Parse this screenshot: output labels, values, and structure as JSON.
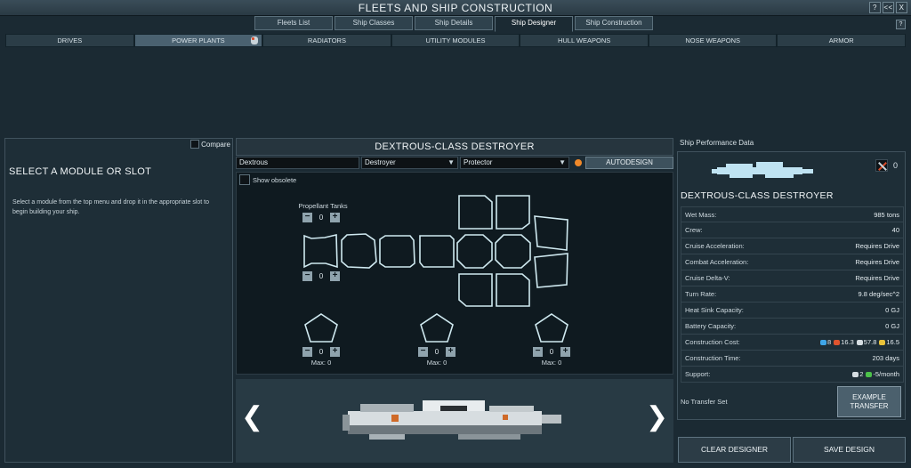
{
  "window": {
    "title": "FLEETS AND SHIP CONSTRUCTION",
    "help": "?",
    "minimize": "<<",
    "close": "X"
  },
  "tabs": [
    {
      "label": "Fleets List"
    },
    {
      "label": "Ship Classes"
    },
    {
      "label": "Ship Details"
    },
    {
      "label": "Ship Designer",
      "active": true
    },
    {
      "label": "Ship Construction"
    }
  ],
  "categories": [
    {
      "label": "DRIVES"
    },
    {
      "label": "POWER PLANTS",
      "active": true
    },
    {
      "label": "RADIATORS"
    },
    {
      "label": "UTILITY MODULES"
    },
    {
      "label": "HULL WEAPONS"
    },
    {
      "label": "NOSE WEAPONS"
    },
    {
      "label": "ARMOR"
    }
  ],
  "left_panel": {
    "compare_label": "Compare",
    "title": "SELECT A MODULE OR SLOT",
    "description": "Select a module from the top menu and drop it in the appropriate slot to begin building your ship."
  },
  "designer": {
    "class_title": "DEXTROUS-CLASS DESTROYER",
    "name_value": "Dextrous",
    "hull_value": "Destroyer",
    "role_value": "Protector",
    "autodesign_label": "AUTODESIGN",
    "show_obsolete_label": "Show obsolete",
    "propellant_label": "Propellant Tanks",
    "propellant_value": "0",
    "propellant_value_2": "0",
    "weapon_mounts": [
      {
        "value": "0",
        "max_label": "Max: 0"
      },
      {
        "value": "0",
        "max_label": "Max: 0"
      },
      {
        "value": "0",
        "max_label": "Max: 0"
      }
    ],
    "prev_arrow": "❮",
    "next_arrow": "❯"
  },
  "performance": {
    "header": "Ship Performance Data",
    "score": "0",
    "ship_name": "DEXTROUS-CLASS DESTROYER",
    "stats": [
      {
        "label": "Wet Mass:",
        "value": "985 tons"
      },
      {
        "label": "Crew:",
        "value": "40"
      },
      {
        "label": "Cruise Acceleration:",
        "value": "Requires Drive"
      },
      {
        "label": "Combat Acceleration:",
        "value": "Requires Drive"
      },
      {
        "label": "Cruise Delta-V:",
        "value": "Requires Drive"
      },
      {
        "label": "Turn Rate:",
        "value": "9.8 deg/sec^2"
      },
      {
        "label": "Heat Sink Capacity:",
        "value": "0 GJ"
      },
      {
        "label": "Battery Capacity:",
        "value": "0 GJ"
      },
      {
        "label": "Construction Cost:",
        "value": ""
      },
      {
        "label": "Construction Time:",
        "value": "203 days"
      },
      {
        "label": "Support:",
        "value": ""
      }
    ],
    "cost": [
      {
        "value": "8",
        "color": "#3fa6e8"
      },
      {
        "value": "16.3",
        "color": "#e0542e"
      },
      {
        "value": "57.8",
        "color": "#d5dde2"
      },
      {
        "value": "16.5",
        "color": "#e8c23a"
      }
    ],
    "support": [
      {
        "value": "2",
        "color": "#d5dde2"
      },
      {
        "value": "-5/month",
        "color": "#4cc24a"
      }
    ],
    "transfer_label": "No Transfer Set",
    "example_transfer_label": "EXAMPLE TRANSFER"
  },
  "buttons": {
    "clear": "CLEAR DESIGNER",
    "save": "SAVE DESIGN"
  },
  "colors": {
    "accent": "#4a6170",
    "slot_outline": "#cfe9f0",
    "orange": "#f0892a"
  }
}
